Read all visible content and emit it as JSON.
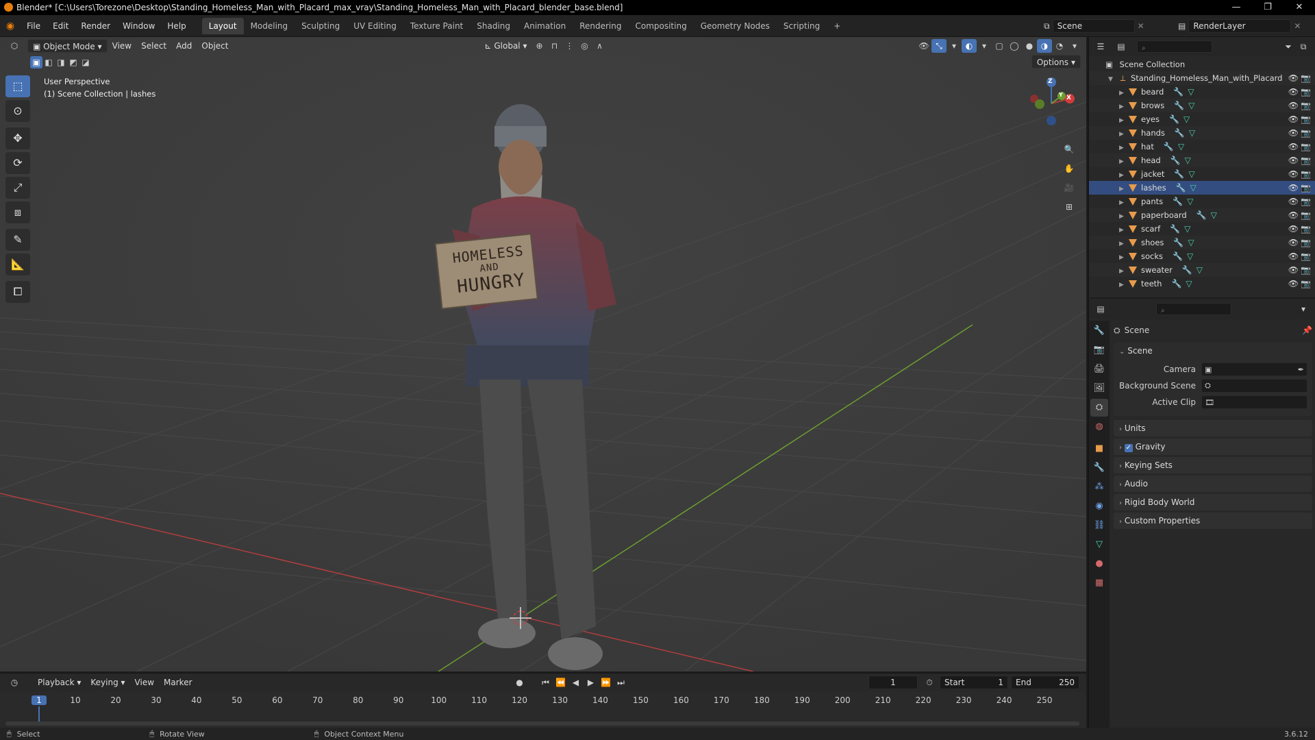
{
  "window": {
    "title": "Blender* [C:\\Users\\Torezone\\Desktop\\Standing_Homeless_Man_with_Placard_max_vray\\Standing_Homeless_Man_with_Placard_blender_base.blend]",
    "minimize": "—",
    "maximize": "❐",
    "close": "✕"
  },
  "menu": [
    "File",
    "Edit",
    "Render",
    "Window",
    "Help"
  ],
  "workspaces": [
    "Layout",
    "Modeling",
    "Sculpting",
    "UV Editing",
    "Texture Paint",
    "Shading",
    "Animation",
    "Rendering",
    "Compositing",
    "Geometry Nodes",
    "Scripting"
  ],
  "workspace_add": "+",
  "scene_field": "Scene",
  "render_layer_field": "RenderLayer",
  "viewport": {
    "mode": "Object Mode",
    "menus": [
      "View",
      "Select",
      "Add",
      "Object"
    ],
    "orientation": "Global",
    "options": "Options",
    "info_line1": "User Perspective",
    "info_line2": "(1) Scene Collection | lashes",
    "gizmo_z": "Z",
    "gizmo_x": "X",
    "gizmo_y": "Y",
    "sign_line1": "HOMELESS",
    "sign_line2": "AND",
    "sign_line3": "HUNGRY"
  },
  "outliner": {
    "root": "Scene Collection",
    "collection": "Standing_Homeless_Man_with_Placard",
    "items": [
      "beard",
      "brows",
      "eyes",
      "hands",
      "hat",
      "head",
      "jacket",
      "lashes",
      "pants",
      "paperboard",
      "scarf",
      "shoes",
      "socks",
      "sweater",
      "teeth"
    ],
    "selected": "lashes"
  },
  "properties": {
    "header": "Scene",
    "section": "Scene",
    "camera_label": "Camera",
    "background_label": "Background Scene",
    "clip_label": "Active Clip",
    "panels": [
      "Units",
      "Gravity",
      "Keying Sets",
      "Audio",
      "Rigid Body World",
      "Custom Properties"
    ]
  },
  "timeline": {
    "menus": [
      "Playback",
      "Keying",
      "View",
      "Marker"
    ],
    "current_frame": "1",
    "start_label": "Start",
    "start_value": "1",
    "end_label": "End",
    "end_value": "250",
    "ticks": [
      "1",
      "10",
      "20",
      "30",
      "40",
      "50",
      "60",
      "70",
      "80",
      "90",
      "100",
      "110",
      "120",
      "130",
      "140",
      "150",
      "160",
      "170",
      "180",
      "190",
      "200",
      "210",
      "220",
      "230",
      "240",
      "250"
    ]
  },
  "status": {
    "select": "Select",
    "rotate": "Rotate View",
    "context": "Object Context Menu",
    "version": "3.6.12"
  },
  "colors": {
    "accent": "#4772b3",
    "x_axis": "#b33d3d",
    "y_axis": "#6c9e2f",
    "object_icon": "#e89b4b",
    "mesh_icon": "#4ed1b0"
  }
}
